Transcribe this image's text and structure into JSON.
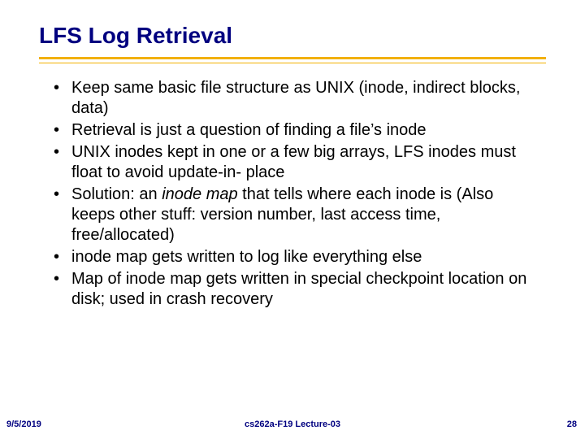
{
  "title": "LFS Log Retrieval",
  "bullets": [
    {
      "pre": "Keep same basic file structure as UNIX (inode, indirect blocks, data)"
    },
    {
      "pre": "Retrieval is just a question of finding a file’s inode"
    },
    {
      "pre": "UNIX inodes kept in one or a few big arrays, LFS inodes must float to avoid update-in- place"
    },
    {
      "pre": "Solution: an ",
      "em": "inode map",
      "post": " that tells where each inode is (Also keeps other stuff: version number, last access time, free/allocated)"
    },
    {
      "pre": "inode map gets written to log like everything else"
    },
    {
      "pre": "Map of inode map gets written in special checkpoint location on disk; used in crash recovery"
    }
  ],
  "footer": {
    "date": "9/5/2019",
    "center": "cs262a-F19 Lecture-03",
    "page": "28"
  }
}
